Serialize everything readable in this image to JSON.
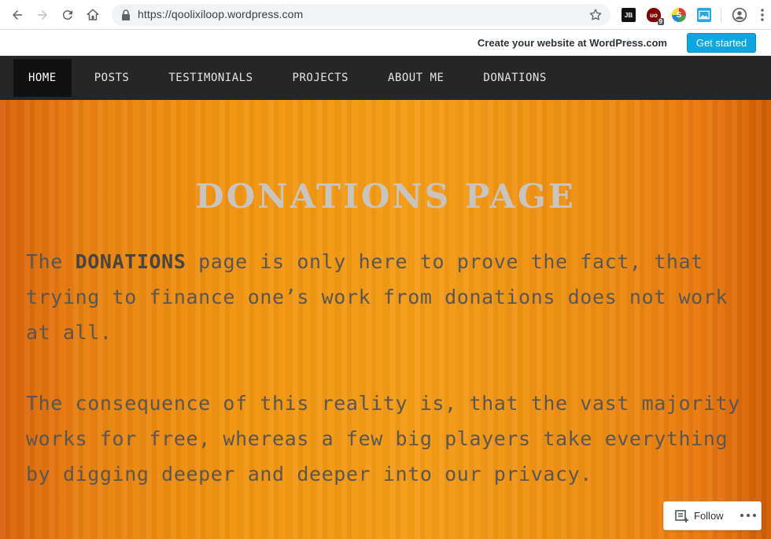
{
  "browser": {
    "url_host": "https://qoolixiloop.wordpress.com",
    "extensions": [
      {
        "name": "jetbrains-extension",
        "label": "JB"
      },
      {
        "name": "ublock-extension",
        "label": "uo",
        "badge": "9"
      },
      {
        "name": "s-extension",
        "label": "S"
      },
      {
        "name": "image-extension",
        "label": ""
      }
    ]
  },
  "wp_bar": {
    "promo_text": "Create your website at WordPress.com",
    "cta_label": "Get started"
  },
  "nav": {
    "items": [
      {
        "label": "HOME",
        "active": true
      },
      {
        "label": "POSTS"
      },
      {
        "label": "TESTIMONIALS"
      },
      {
        "label": "PROJECTS"
      },
      {
        "label": "ABOUT ME"
      },
      {
        "label": "DONATIONS"
      }
    ]
  },
  "page": {
    "title": "DONATIONS PAGE",
    "p1_pre": "The ",
    "p1_bold": "DONATIONS",
    "p1_post": " page is only here to prove the fact, that trying to finance one’s work from donations does not work at all.",
    "p2": "The consequence of this reality is, that the vast majority works for free, whereas a few big players take everything by digging deeper and deeper into our privacy."
  },
  "follow": {
    "label": "Follow"
  },
  "colors": {
    "nav_bg": "#262626",
    "accent_button": "#0ea5e0",
    "hero_orange": "#f29511"
  }
}
